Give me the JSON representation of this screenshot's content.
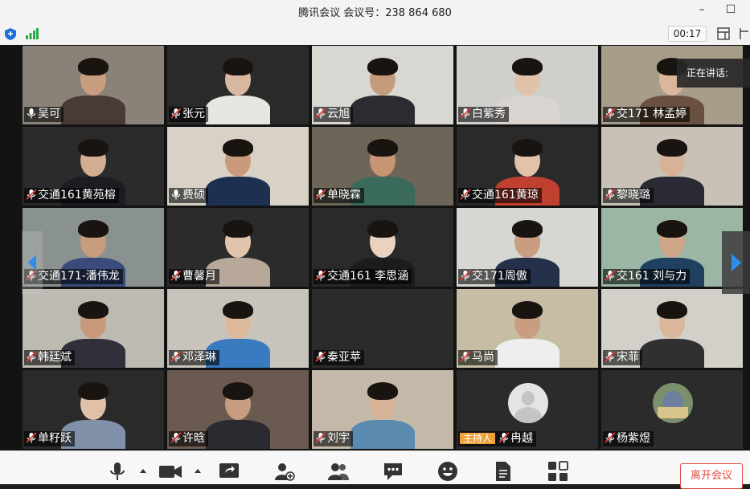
{
  "window": {
    "title": "腾讯会议 会议号：238 864 680",
    "minimize": "–",
    "maximize": "☐"
  },
  "topbar": {
    "timer": "00:17"
  },
  "speaking": {
    "label": "正在讲话:"
  },
  "participants": [
    {
      "name": "吴可",
      "muted": false,
      "bg": "#8a8278",
      "skin": "#c99d80",
      "shirt": "#4a3a35"
    },
    {
      "name": "张元",
      "muted": true,
      "bg": "#2a2a2a",
      "skin": "#d8b8a0",
      "shirt": "#e8e6e0"
    },
    {
      "name": "云旭",
      "muted": true,
      "bg": "#d9d7d2",
      "skin": "#c59b7c",
      "shirt": "#2c2c30"
    },
    {
      "name": "白紫秀",
      "muted": true,
      "bg": "#cfcfcc",
      "skin": "#e0c2aa",
      "shirt": "#d9d4cf"
    },
    {
      "name": "交171 林孟婷",
      "muted": true,
      "bg": "#a89c8a",
      "skin": "#dab69a",
      "shirt": "#6a5040"
    },
    {
      "name": "交通161黄苑榕",
      "muted": true,
      "bg": "#2b2b2b",
      "skin": "#d3ad92",
      "shirt": "#1c1c22"
    },
    {
      "name": "费硕",
      "muted": false,
      "bg": "#d8d2c6",
      "skin": "#c99a7b",
      "shirt": "#1e3050"
    },
    {
      "name": "单晓霖",
      "muted": true,
      "bg": "#6d6658",
      "skin": "#c69574",
      "shirt": "#3a6a5a"
    },
    {
      "name": "交通161黄琼",
      "muted": true,
      "bg": "#2a2a2a",
      "skin": "#e2c2a8",
      "shirt": "#c04030"
    },
    {
      "name": "黎晓璐",
      "muted": true,
      "bg": "#c8c2b6",
      "skin": "#d6b296",
      "shirt": "#2a2a35"
    },
    {
      "name": "交通171-潘伟龙",
      "muted": true,
      "bg": "#8a9290",
      "skin": "#c89c7e",
      "shirt": "#3a4a7a"
    },
    {
      "name": "曹馨月",
      "muted": true,
      "bg": "#2b2b2b",
      "skin": "#e2c5ad",
      "shirt": "#b8a89a"
    },
    {
      "name": "交通161 李思涵",
      "muted": true,
      "bg": "#2a2a2a",
      "skin": "#ead2bf",
      "shirt": "#1c1c1c"
    },
    {
      "name": "交171周傲",
      "muted": true,
      "bg": "#d6d6d2",
      "skin": "#c99d80",
      "shirt": "#25304a"
    },
    {
      "name": "交161 刘与力",
      "muted": true,
      "bg": "#9cb6a6",
      "skin": "#d0a688",
      "shirt": "#204060"
    },
    {
      "name": "韩廷斌",
      "muted": true,
      "bg": "#bdbab2",
      "skin": "#c8987a",
      "shirt": "#30303a"
    },
    {
      "name": "邓泽琳",
      "muted": true,
      "bg": "#c8c4bc",
      "skin": "#dcb89c",
      "shirt": "#3a7ac0"
    },
    {
      "name": "秦亚苹",
      "muted": true,
      "bg": "#2b2b2b",
      "skin": "",
      "shirt": ""
    },
    {
      "name": "马尚",
      "muted": true,
      "bg": "#c6bda4",
      "skin": "#c99d80",
      "shirt": "#eeeeee"
    },
    {
      "name": "宋菲",
      "muted": true,
      "bg": "#d2d0c8",
      "skin": "#dab69a",
      "shirt": "#303030"
    },
    {
      "name": "单籽跃",
      "muted": true,
      "bg": "#2a2a2a",
      "skin": "#e0c0a6",
      "shirt": "#8090a8"
    },
    {
      "name": "许晗",
      "muted": true,
      "bg": "#6a5a50",
      "skin": "#c79c80",
      "shirt": "#2a2a30"
    },
    {
      "name": "刘宇",
      "muted": true,
      "bg": "#c4b9a8",
      "skin": "#d6b296",
      "shirt": "#5a8ab0"
    },
    {
      "name": "冉越",
      "muted": true,
      "bg": "#2b2b2b",
      "skin": "",
      "shirt": "",
      "host": "主持人",
      "avatar": "placeholder"
    },
    {
      "name": "杨紫煜",
      "muted": true,
      "bg": "#2b2b2b",
      "skin": "",
      "shirt": "",
      "avatar": "cartoon"
    }
  ],
  "toolbar": {
    "leave_label": "离开会议"
  },
  "colors": {
    "accent_blue": "#1e6fd9",
    "leave_red": "#e04a3f",
    "host_orange": "#f0a23a",
    "muted_red": "#e53935"
  }
}
